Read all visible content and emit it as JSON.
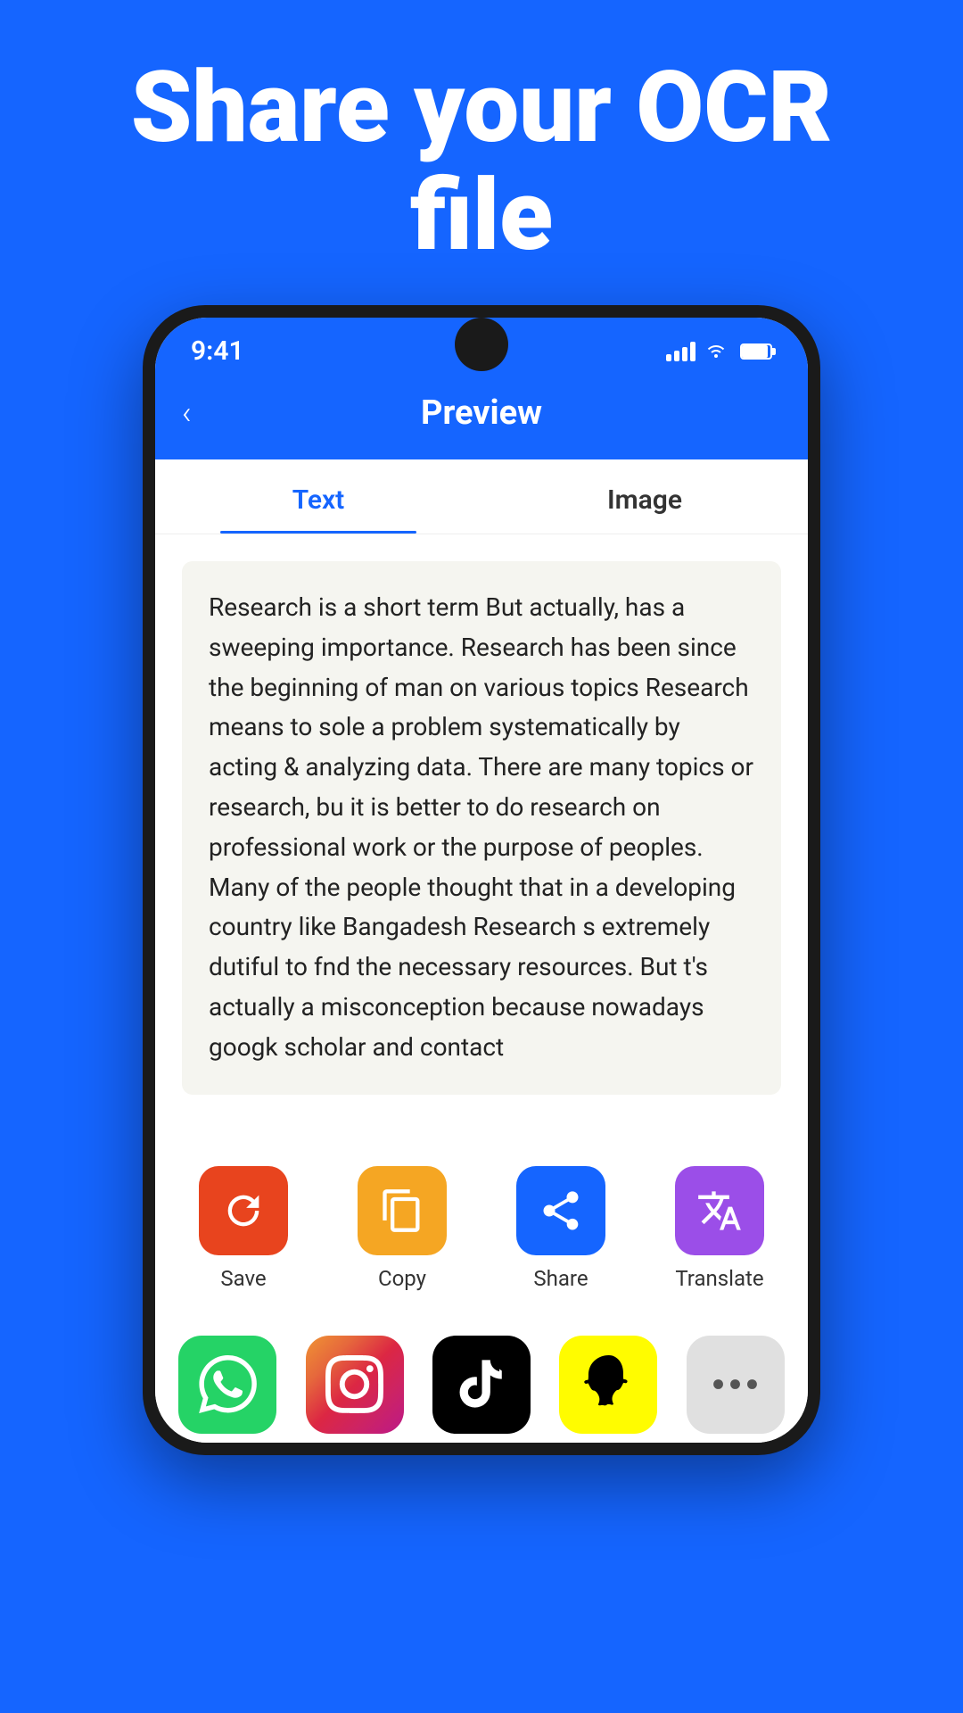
{
  "hero": {
    "title": "Share your OCR file"
  },
  "status_bar": {
    "time": "9:41"
  },
  "header": {
    "title": "Preview",
    "back_label": "‹"
  },
  "tabs": [
    {
      "id": "text",
      "label": "Text",
      "active": true
    },
    {
      "id": "image",
      "label": "Image",
      "active": false
    }
  ],
  "ocr_text": "Research is a short term But actually, has a sweeping importance. Research has been since the beginning of man on various topics Research means to sole a problem systematically by  acting & analyzing data. There are many topics or research, bu it is better to do research on professional work or the purpose of peoples. Many of the people thought that in a developing country like Bangadesh Research s extremely dutiful to fnd the necessary resources. But t's actually a misconception because nowadays googk scholar and contact",
  "actions": [
    {
      "id": "save",
      "label": "Save",
      "icon": "save",
      "color_class": "icon-save"
    },
    {
      "id": "copy",
      "label": "Copy",
      "icon": "copy",
      "color_class": "icon-copy"
    },
    {
      "id": "share",
      "label": "Share",
      "icon": "share",
      "color_class": "icon-share"
    },
    {
      "id": "translate",
      "label": "Translate",
      "icon": "translate",
      "color_class": "icon-translate"
    }
  ],
  "social_apps": [
    {
      "id": "whatsapp",
      "label": "WhatsApp"
    },
    {
      "id": "instagram",
      "label": "Instagram"
    },
    {
      "id": "tiktok",
      "label": "TikTok"
    },
    {
      "id": "snapchat",
      "label": "Snapchat"
    },
    {
      "id": "more",
      "label": "More"
    }
  ]
}
